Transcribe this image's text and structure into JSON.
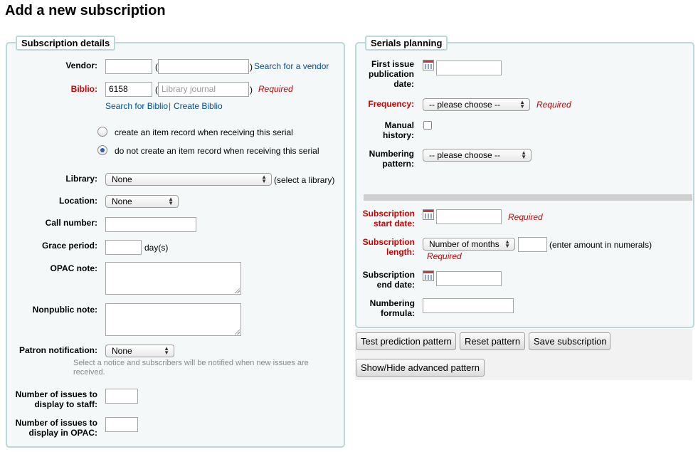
{
  "page_title": "Add a new subscription",
  "details": {
    "legend": "Subscription details",
    "vendor": {
      "label": "Vendor:",
      "value": "",
      "name_value": "",
      "paren_open": "(",
      "paren_close": ")",
      "search_link": "Search for a vendor"
    },
    "biblio": {
      "label": "Biblio:",
      "value": "6158",
      "name_value": "Library journal",
      "paren_open": "(",
      "paren_close": ")",
      "required": "Required",
      "search_link": "Search for Biblio",
      "separator": "|",
      "create_link": "Create Biblio"
    },
    "item_record": {
      "create_label": "create an item record when receiving this serial",
      "no_create_label": "do not create an item record when receiving this serial",
      "selected": "no_create"
    },
    "library": {
      "label": "Library:",
      "selected": "None",
      "hint": "(select a library)"
    },
    "location": {
      "label": "Location:",
      "selected": "None"
    },
    "call_number": {
      "label": "Call number:",
      "value": ""
    },
    "grace_period": {
      "label": "Grace period:",
      "value": "",
      "unit": "day(s)"
    },
    "opac_note": {
      "label": "OPAC note:",
      "value": ""
    },
    "nonpublic_note": {
      "label": "Nonpublic note:",
      "value": ""
    },
    "patron_notification": {
      "label": "Patron notification:",
      "selected": "None",
      "hint": "Select a notice and subscribers will be notified when new issues are received."
    },
    "issues_staff": {
      "label": "Number of issues to display to staff:",
      "value": ""
    },
    "issues_opac": {
      "label": "Number of issues to display in OPAC:",
      "value": ""
    }
  },
  "planning": {
    "legend": "Serials planning",
    "first_issue": {
      "label": "First issue publication date:",
      "value": ""
    },
    "frequency": {
      "label": "Frequency:",
      "selected": "-- please choose --",
      "required": "Required"
    },
    "manual_history": {
      "label": "Manual history:",
      "checked": false
    },
    "numbering_pattern": {
      "label": "Numbering pattern:",
      "selected": "-- please choose --"
    },
    "start_date": {
      "label": "Subscription start date:",
      "value": "",
      "required": "Required"
    },
    "length": {
      "label": "Subscription length:",
      "unit_selected": "Number of months",
      "value": "",
      "hint": "(enter amount in numerals)",
      "required": "Required"
    },
    "end_date": {
      "label": "Subscription end date:",
      "value": ""
    },
    "numbering_formula": {
      "label": "Numbering formula:",
      "value": ""
    }
  },
  "buttons": {
    "test_prediction": "Test prediction pattern",
    "reset_pattern": "Reset pattern",
    "save_subscription": "Save subscription",
    "show_hide_advanced": "Show/Hide advanced pattern"
  },
  "colors": {
    "required": "#cc0000",
    "link": "#004d99",
    "fieldset_border": "#b9d8d9",
    "fieldset_bg": "#f4f8f9"
  }
}
